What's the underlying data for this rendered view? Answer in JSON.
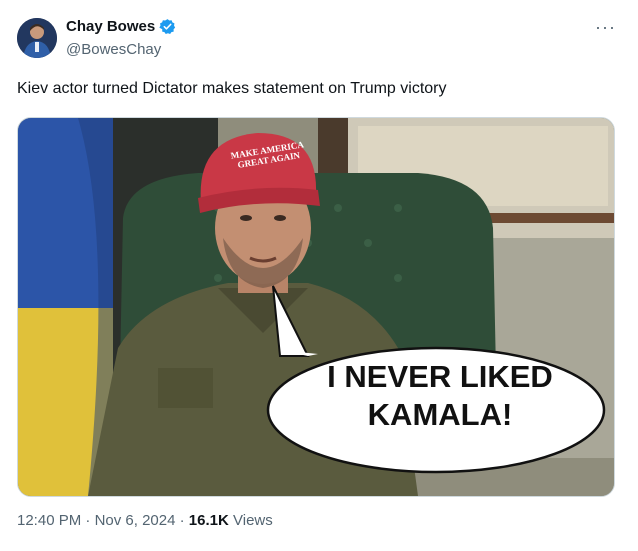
{
  "author": {
    "display_name": "Chay Bowes",
    "handle": "@BowesChay",
    "verified": true
  },
  "tweet": {
    "text": "Kiev actor turned Dictator makes statement on Trump victory",
    "image": {
      "hat_text": "MAKE AMERICA GREAT AGAIN",
      "speech_bubble": "I NEVER LIKED KAMALA!"
    }
  },
  "meta": {
    "time": "12:40 PM",
    "date": "Nov 6, 2024",
    "views_count": "16.1K",
    "views_label": "Views",
    "separator": " · "
  },
  "icons": {
    "more": "more-horizontal-icon",
    "verified": "verified-badge-icon"
  },
  "colors": {
    "verified_blue": "#1d9bf0",
    "secondary_text": "#536471"
  }
}
